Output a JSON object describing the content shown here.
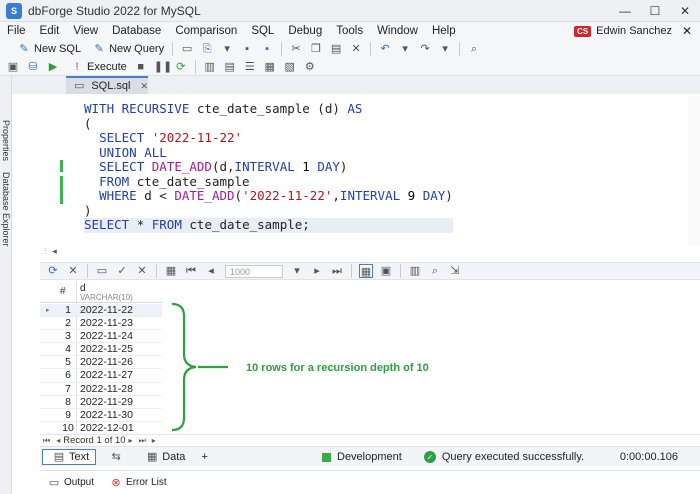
{
  "window": {
    "title": "dbForge Studio 2022 for MySQL",
    "logo_text": "S",
    "minimize": "—",
    "maximize": "☐",
    "close": "✕"
  },
  "menu": {
    "items": [
      "File",
      "Edit",
      "View",
      "Database",
      "Comparison",
      "SQL",
      "Debug",
      "Tools",
      "Window",
      "Help"
    ],
    "user_badge": "CS",
    "user_name": "Edwin Sanchez",
    "close": "✕"
  },
  "toolbar": {
    "new_sql": "New SQL",
    "new_query": "New Query",
    "execute": "Execute"
  },
  "sidebar": {
    "properties": "Properties",
    "database_explorer": "Database Explorer"
  },
  "tab": {
    "label": "SQL.sql",
    "close": "✕"
  },
  "editor": {
    "lines": [
      {
        "parts": [
          [
            "kw",
            "WITH RECURSIVE "
          ],
          [
            "",
            "cte_date_sample (d) "
          ],
          [
            "kw",
            "AS"
          ]
        ]
      },
      {
        "parts": [
          [
            "",
            "("
          ]
        ]
      },
      {
        "parts": [
          [
            "",
            "  "
          ],
          [
            "kw",
            "SELECT "
          ],
          [
            "str",
            "'2022-11-22'"
          ]
        ]
      },
      {
        "parts": [
          [
            "",
            "  "
          ],
          [
            "kw",
            "UNION ALL"
          ]
        ]
      },
      {
        "parts": [
          [
            "",
            "  "
          ],
          [
            "kw",
            "SELECT "
          ],
          [
            "fn",
            "DATE_ADD"
          ],
          [
            "",
            "(d,"
          ],
          [
            "kw",
            "INTERVAL "
          ],
          [
            "num",
            "1 "
          ],
          [
            "kw",
            "DAY"
          ],
          [
            "",
            ")"
          ]
        ]
      },
      {
        "parts": [
          [
            "",
            "  "
          ],
          [
            "kw",
            "FROM "
          ],
          [
            "",
            "cte_date_sample"
          ]
        ]
      },
      {
        "parts": [
          [
            "",
            "  "
          ],
          [
            "kw",
            "WHERE "
          ],
          [
            "",
            "d < "
          ],
          [
            "fn",
            "DATE_ADD"
          ],
          [
            "",
            "("
          ],
          [
            "str",
            "'2022-11-22'"
          ],
          [
            "",
            ","
          ],
          [
            "kw",
            "INTERVAL "
          ],
          [
            "num",
            "9 "
          ],
          [
            "kw",
            "DAY"
          ],
          [
            "",
            ")"
          ]
        ]
      },
      {
        "parts": [
          [
            "",
            ")"
          ]
        ]
      },
      {
        "parts": [
          [
            "kw",
            "SELECT "
          ],
          [
            "",
            "* "
          ],
          [
            "kw",
            "FROM "
          ],
          [
            "",
            "cte_date_sample;"
          ]
        ]
      }
    ],
    "current_line": 8
  },
  "grid_toolbar": {
    "page_size": "1000"
  },
  "grid": {
    "row_header": "#",
    "column_name": "d",
    "column_type": "VARCHAR(10)",
    "rows": [
      {
        "n": "1",
        "d": "2022-11-22"
      },
      {
        "n": "2",
        "d": "2022-11-23"
      },
      {
        "n": "3",
        "d": "2022-11-24"
      },
      {
        "n": "4",
        "d": "2022-11-25"
      },
      {
        "n": "5",
        "d": "2022-11-26"
      },
      {
        "n": "6",
        "d": "2022-11-27"
      },
      {
        "n": "7",
        "d": "2022-11-28"
      },
      {
        "n": "8",
        "d": "2022-11-29"
      },
      {
        "n": "9",
        "d": "2022-11-30"
      },
      {
        "n": "10",
        "d": "2022-12-01"
      }
    ]
  },
  "annotation": "10 rows for a recursion depth of 10",
  "record_bar": {
    "label": "Record 1 of 10"
  },
  "status": {
    "text_tab": "Text",
    "data_tab": "Data",
    "add_tab": "+",
    "environment": "Development",
    "message": "Query executed successfully.",
    "elapsed": "0:00:00.106"
  },
  "bottom_panel": {
    "output": "Output",
    "error_list": "Error List"
  },
  "colors": {
    "accent": "#4a7cc9",
    "success": "#2ea043",
    "annotation": "#2ba23a",
    "keyword": "#1f3fb8",
    "string": "#b3181f",
    "function": "#a21b9c"
  }
}
